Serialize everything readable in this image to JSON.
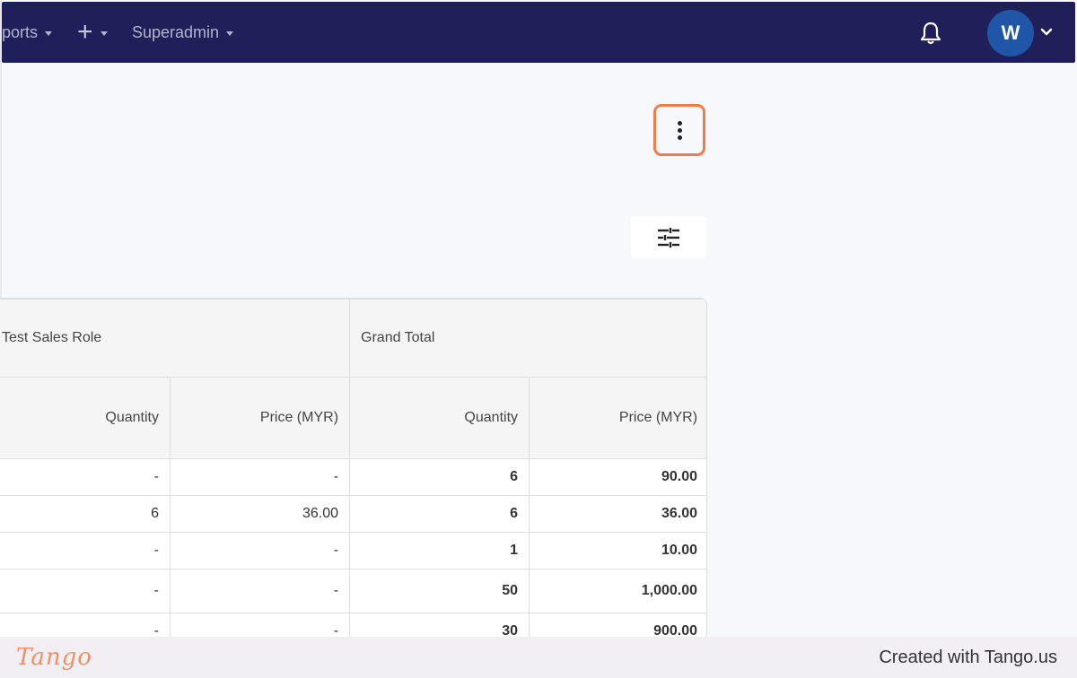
{
  "navbar": {
    "reports_label": "ports",
    "add_label": "+",
    "superadmin_label": "Superadmin",
    "avatar_initial": "W"
  },
  "table": {
    "group_headers": [
      "Test Sales Role",
      "Grand Total"
    ],
    "sub_headers": [
      "Quantity",
      "Price (MYR)",
      "Quantity",
      "Price (MYR)"
    ],
    "rows": [
      [
        "-",
        "-",
        "6",
        "90.00"
      ],
      [
        "6",
        "36.00",
        "6",
        "36.00"
      ],
      [
        "-",
        "-",
        "1",
        "10.00"
      ],
      [
        "-",
        "-",
        "50",
        "1,000.00"
      ],
      [
        "-",
        "-",
        "30",
        "900.00"
      ]
    ]
  },
  "footer": {
    "logo_text": "Tango",
    "created_text": "Created with Tango.us"
  },
  "colors": {
    "navbar_bg": "#201f5a",
    "highlight": "#f07b4b",
    "avatar_bg": "#1f56a8"
  }
}
